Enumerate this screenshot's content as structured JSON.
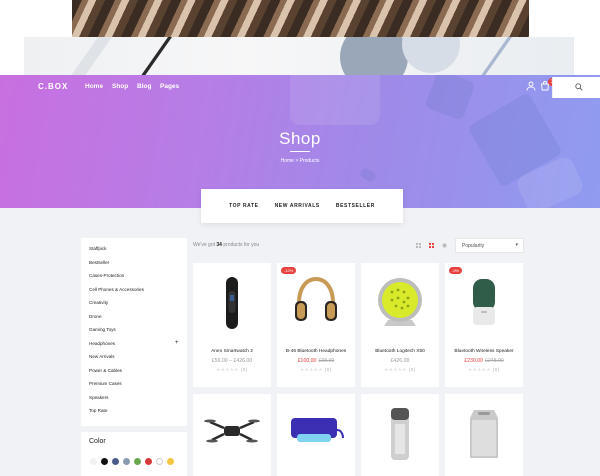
{
  "nav": {
    "logo": "C.BOX",
    "items": [
      "Home",
      "Shop",
      "Blog",
      "Pages"
    ],
    "cart_count": "3"
  },
  "hero": {
    "title": "Shop",
    "breadcrumb": "Home  >  Products"
  },
  "tabs": [
    "TOP RATE",
    "NEW ARRIVALS",
    "BESTSELLER"
  ],
  "sidebar": {
    "categories": [
      "Staffpick",
      "Bestseller",
      "Cases-Protection",
      "Cell Phones & Accessories",
      "Creativity",
      "Drone",
      "Gaming Toys",
      "Headphones",
      "New Arrivals",
      "Power & Cables",
      "Premium Cases",
      "Speakers",
      "Top Rate"
    ],
    "expand_symbol": "+"
  },
  "color_filter": {
    "title": "Color",
    "swatches": [
      "#f2f2f2",
      "#111111",
      "#4a5a8c",
      "#8a9bb0",
      "#6aa84f",
      "#d63a3a",
      "#ffffff",
      "#f4c542"
    ]
  },
  "toolbar": {
    "result_prefix": "We've got",
    "result_count": "34",
    "result_suffix": "products for you",
    "sort_value": "Popularity"
  },
  "products": [
    {
      "name": "Aneo Smartwatch 2",
      "price": "£56.00 – £426.00",
      "old_price": "",
      "sale": "",
      "reviews": "(0)"
    },
    {
      "name": "B-46 Bluetooth Headphones",
      "price": "£100.00",
      "old_price": "£98.00",
      "sale": "-12%",
      "reviews": "(0)"
    },
    {
      "name": "Bluetooth Logitech X50",
      "price": "£426.00",
      "old_price": "",
      "sale": "",
      "reviews": "(0)"
    },
    {
      "name": "Bluetooth Wireless Speaker",
      "price": "£230.00",
      "old_price": "£248.00",
      "sale": "-9%",
      "reviews": "(0)"
    }
  ],
  "rating_stars": "★★★★★",
  "accent_color": "#e8423e"
}
